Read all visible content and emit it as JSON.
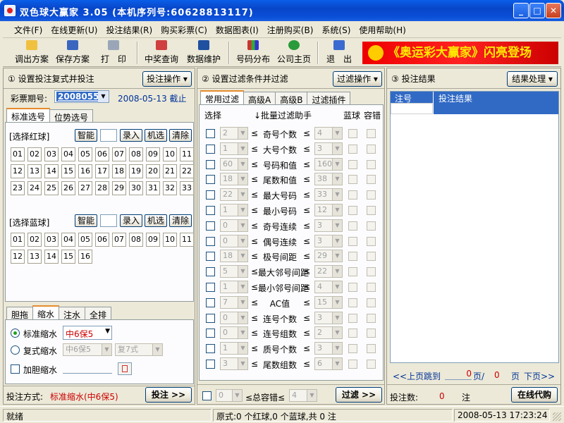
{
  "window": {
    "title": "双色球大赢家  3.05  (本机序列号:60628813117)"
  },
  "menu": [
    "文件(F)",
    "在线更新(U)",
    "投注结果(R)",
    "购买彩票(C)",
    "数据图表(I)",
    "注册购买(B)",
    "系统(S)",
    "使用帮助(H)"
  ],
  "toolbar": {
    "load": "调出方案",
    "save": "保存方案",
    "print": "打　印",
    "prize": "中奖查询",
    "maintain": "数据维护",
    "dist": "号码分布",
    "home": "公司主页",
    "exit": "退　出",
    "banner": "《奥运彩大赢家》闪亮登场"
  },
  "left": {
    "title": "① 设置投注复式并投注",
    "op_btn": "投注操作 ▾",
    "period_label": "彩票期号:",
    "period_value": "2008055",
    "deadline": "2008-05-13 截止",
    "tabs": [
      "标准选号",
      "位势选号"
    ],
    "red_label": "[选择红球]",
    "blue_label": "[选择蓝球]",
    "btn_smart": "智能",
    "btn_enter": "录入",
    "btn_random": "机选",
    "btn_clear": "清除",
    "red_numbers": [
      "01",
      "02",
      "03",
      "04",
      "05",
      "06",
      "07",
      "08",
      "09",
      "10",
      "11",
      "12",
      "13",
      "14",
      "15",
      "16",
      "17",
      "18",
      "19",
      "20",
      "21",
      "22",
      "23",
      "24",
      "25",
      "26",
      "27",
      "28",
      "29",
      "30",
      "31",
      "32",
      "33"
    ],
    "blue_numbers": [
      "01",
      "02",
      "03",
      "04",
      "05",
      "06",
      "07",
      "08",
      "09",
      "10",
      "11",
      "12",
      "13",
      "14",
      "15",
      "16"
    ],
    "bottom_tabs": [
      "胆拖",
      "缩水",
      "注水",
      "全排"
    ],
    "std_shrink": "标准缩水",
    "std_shrink_value": "中6保5",
    "multi_shrink": "复式缩水",
    "multi_val1": "中6保5",
    "multi_val2": "复7式",
    "dan_shrink": "加胆缩水",
    "bet_mode_label": "投注方式:",
    "bet_mode_value": "标准缩水(中6保5)",
    "bet_btn": "投注 >>"
  },
  "mid": {
    "title": "② 设置过滤条件并过滤",
    "op_btn": "过滤操作 ▾",
    "tabs": [
      "常用过滤",
      "高级A",
      "高级B",
      "过滤插件"
    ],
    "col_select": "选择",
    "col_helper": "↓批量过滤助手",
    "col_blue": "蓝球",
    "col_tol": "容错",
    "rows": [
      {
        "min": "2",
        "label": "奇号个数",
        "max": "4"
      },
      {
        "min": "1",
        "label": "大号个数",
        "max": "3"
      },
      {
        "min": "60",
        "label": "号码和值",
        "max": "160"
      },
      {
        "min": "18",
        "label": "尾数和值",
        "max": "38"
      },
      {
        "min": "22",
        "label": "最大号码",
        "max": "33"
      },
      {
        "min": "1",
        "label": "最小号码",
        "max": "12"
      },
      {
        "min": "0",
        "label": "奇号连续",
        "max": "3"
      },
      {
        "min": "0",
        "label": "偶号连续",
        "max": "3"
      },
      {
        "min": "18",
        "label": "极号间距",
        "max": "29"
      },
      {
        "min": "5",
        "label": "最大邻号间距",
        "max": "22"
      },
      {
        "min": "1",
        "label": "最小邻号间距",
        "max": "4"
      },
      {
        "min": "7",
        "label": "AC值",
        "max": "15"
      },
      {
        "min": "0",
        "label": "连号个数",
        "max": "3"
      },
      {
        "min": "0",
        "label": "连号组数",
        "max": "2"
      },
      {
        "min": "1",
        "label": "质号个数",
        "max": "3"
      },
      {
        "min": "3",
        "label": "尾数组数",
        "max": "6"
      }
    ],
    "leq": "≤",
    "total_min": "0",
    "total_label": "≤总容错≤",
    "total_max": "4",
    "filter_btn": "过滤 >>"
  },
  "right": {
    "title": "③ 投注结果",
    "op_btn": "结果处理 ▾",
    "col_no": "注号",
    "col_result": "投注结果",
    "prev": "<<上页",
    "jump": "跳到",
    "page_cur": "0",
    "page_sep": "页/",
    "page_total": "0",
    "page_unit": "页",
    "next": "下页>>",
    "bet_count_label": "投注数:",
    "bet_count": "0",
    "bet_unit": "注",
    "online_btn": "在线代购"
  },
  "status": {
    "ready": "就绪",
    "summary": "原式:0 个红球,0 个蓝球,共 0 注",
    "datetime": "2008-05-13  17:23:24"
  },
  "colors": {
    "title_blue": "#0a4fd8",
    "accent_red": "#c00",
    "link_blue": "#003399",
    "selection": "#316ac5"
  }
}
